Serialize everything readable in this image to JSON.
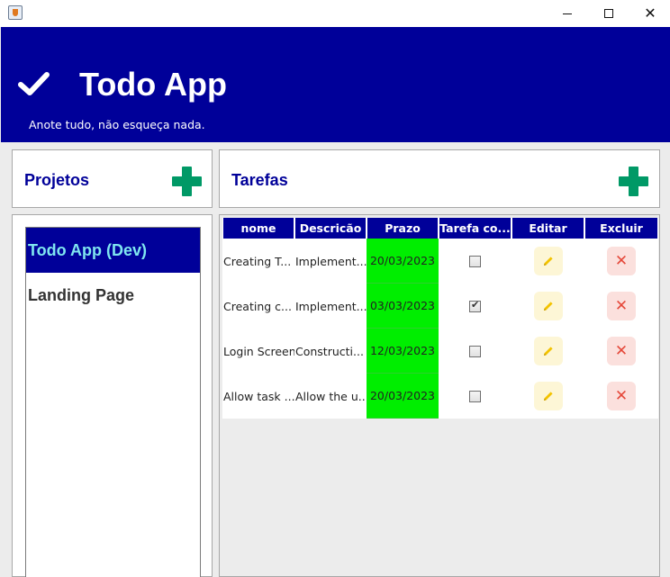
{
  "window": {
    "title": ""
  },
  "header": {
    "title": "Todo App",
    "subtitle": "Anote tudo, não esqueça nada.",
    "bg_color": "#000099"
  },
  "projects_panel": {
    "title": "Projetos",
    "add_icon": "plus-icon",
    "items": [
      {
        "label": "Todo App (Dev)",
        "selected": true
      },
      {
        "label": "Landing Page",
        "selected": false
      }
    ]
  },
  "tasks_panel": {
    "title": "Tarefas",
    "add_icon": "plus-icon",
    "columns": [
      "nome",
      "Descricão",
      "Prazo",
      "Tarefa co...",
      "Editar",
      "Excluir"
    ],
    "rows": [
      {
        "nome": "Creating T...",
        "descricao": "Implement...",
        "prazo": "20/03/2023",
        "concluida": false
      },
      {
        "nome": "Creating c...",
        "descricao": "Implement...",
        "prazo": "03/03/2023",
        "concluida": true
      },
      {
        "nome": "Login Screen",
        "descricao": "Constructi...",
        "prazo": "12/03/2023",
        "concluida": false
      },
      {
        "nome": "Allow task ...",
        "descricao": "Allow the u...",
        "prazo": "20/03/2023",
        "concluida": false
      }
    ]
  },
  "colors": {
    "accent": "#000099",
    "add_green": "#009966",
    "deadline_green": "#00ee00",
    "selected_text": "#7fe6f0",
    "edit_bg": "#fdf6d6",
    "delete_bg": "#fbe0dd",
    "delete_x": "#e5483a"
  }
}
